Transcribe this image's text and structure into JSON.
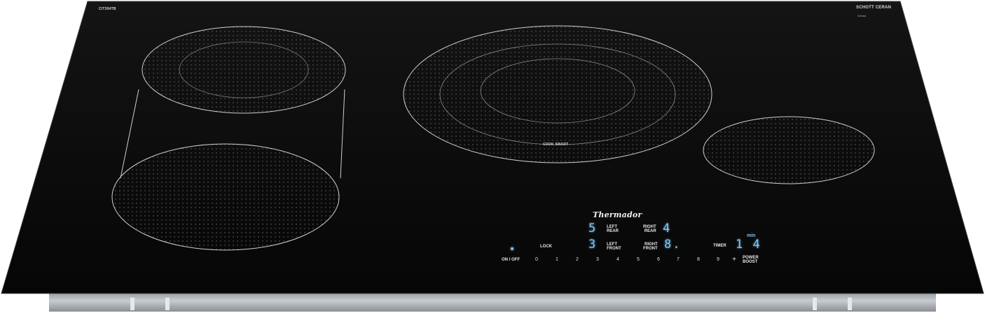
{
  "product": {
    "brand": "Thermador",
    "glass_maker": "SCHOTT CERAN",
    "model_code": "CIT304TB",
    "glass_sub": "Ceran"
  },
  "cooktop": {
    "center_label": "COOK SMART"
  },
  "displays": {
    "left_rear": {
      "value": "5",
      "label_line1": "LEFT",
      "label_line2": "REAR"
    },
    "right_rear": {
      "value": "4",
      "label_line1": "RIGHT",
      "label_line2": "REAR"
    },
    "left_front": {
      "value": "3",
      "label_line1": "LEFT",
      "label_line2": "FRONT"
    },
    "right_front": {
      "value": "8.",
      "label_line1": "RIGHT",
      "label_line2": "FRONT"
    },
    "timer": {
      "value": "1 4",
      "label": "TIMER",
      "unit": "min"
    }
  },
  "controls": {
    "on_off": "ON I OFF",
    "lock": "LOCK",
    "digits": [
      "0",
      "1",
      "2",
      "3",
      "4",
      "5",
      "6",
      "7",
      "8",
      "9"
    ],
    "plus": "+",
    "power_boost_line1": "POWER",
    "power_boost_line2": "BOOST"
  },
  "colors": {
    "glass": "#0a0a0a",
    "display": "#7fc4f0",
    "frame": "#a4a9ae"
  }
}
